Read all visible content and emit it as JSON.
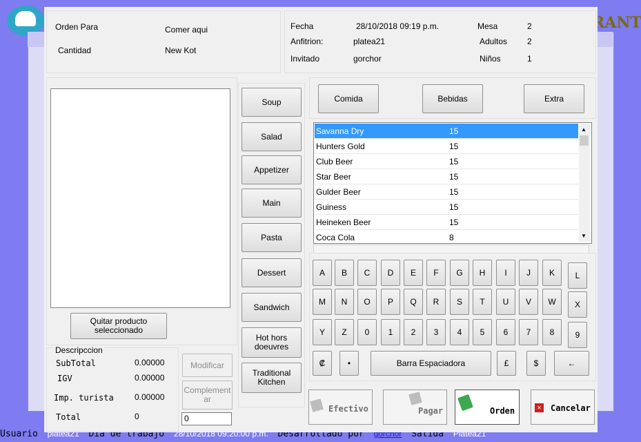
{
  "background": {
    "brand_text": "RANT",
    "status": {
      "usuario_label": "Usuario",
      "usuario": "platea21",
      "dia_label": "Dia de trabajo",
      "dia": "28/10/2018 09:20:00 p.m.",
      "dev_label": "Desarrollado por",
      "dev": "gorchor",
      "salida_label": "Salida",
      "salida": "Platea21"
    }
  },
  "header_left": {
    "orden_para_label": "Orden Para",
    "orden_para_value": "Comer aqui",
    "cantidad_label": "Cantidad",
    "cantidad_value": "New Kot"
  },
  "header_right": {
    "fecha_label": "Fecha",
    "fecha_value": "28/10/2018 09:19 p.m.",
    "anfitrion_label": "Anfitrion:",
    "anfitrion_value": "platea21",
    "invitado_label": "Invitado",
    "invitado_value": "gorchor",
    "mesa_label": "Mesa",
    "mesa_value": "2",
    "adultos_label": "Adultos",
    "adultos_value": "2",
    "ninos_label": "Niños",
    "ninos_value": "1"
  },
  "order": {
    "remove_button": "Quitar producto seleccionado",
    "descripcion_label": "Descripccion",
    "subtotal_label": "SubTotal",
    "subtotal_value": "0.00000",
    "igv_label": "IGV",
    "igv_value": "0.00000",
    "imp_label": "Imp. turista",
    "imp_value": "0.00000",
    "total_label": "Total",
    "total_value": "0",
    "modificar_button": "Modificar",
    "complementar_button": "Complement ar",
    "quantity_value": "0"
  },
  "categories": [
    "Soup",
    "Salad",
    "Appetizer",
    "Main",
    "Pasta",
    "Dessert",
    "Sandwich",
    "Hot hors doeuvres",
    "Traditional Kitchen"
  ],
  "type_tabs": [
    "Comida",
    "Bebidas",
    "Extra"
  ],
  "products": [
    {
      "name": "Savanna Dry",
      "price": "15",
      "selected": true
    },
    {
      "name": "Hunters Gold",
      "price": "15"
    },
    {
      "name": "Club Beer",
      "price": "15"
    },
    {
      "name": "Star Beer",
      "price": "15"
    },
    {
      "name": "Gulder Beer",
      "price": "15"
    },
    {
      "name": "Guiness",
      "price": "15"
    },
    {
      "name": "Heineken Beer",
      "price": "15"
    },
    {
      "name": "Coca Cola",
      "price": "8"
    }
  ],
  "search_value": "",
  "keyboard": {
    "row1": [
      "A",
      "B",
      "C",
      "D",
      "E",
      "F",
      "G",
      "H",
      "I",
      "J",
      "K",
      "L"
    ],
    "row2": [
      "M",
      "N",
      "O",
      "P",
      "Q",
      "R",
      "S",
      "T",
      "U",
      "V",
      "W",
      "X"
    ],
    "row3": [
      "Y",
      "Z",
      "0",
      "1",
      "2",
      "3",
      "4",
      "5",
      "6",
      "7",
      "8",
      "9"
    ],
    "row4_left": [
      "₡",
      "•"
    ],
    "space": "Barra Espaciadora",
    "row4_right": [
      "£",
      "$",
      "←"
    ]
  },
  "actions": {
    "efectivo": "Efectivo",
    "pagar": "Pagar",
    "orden": "Orden",
    "cancelar": "Cancelar"
  }
}
